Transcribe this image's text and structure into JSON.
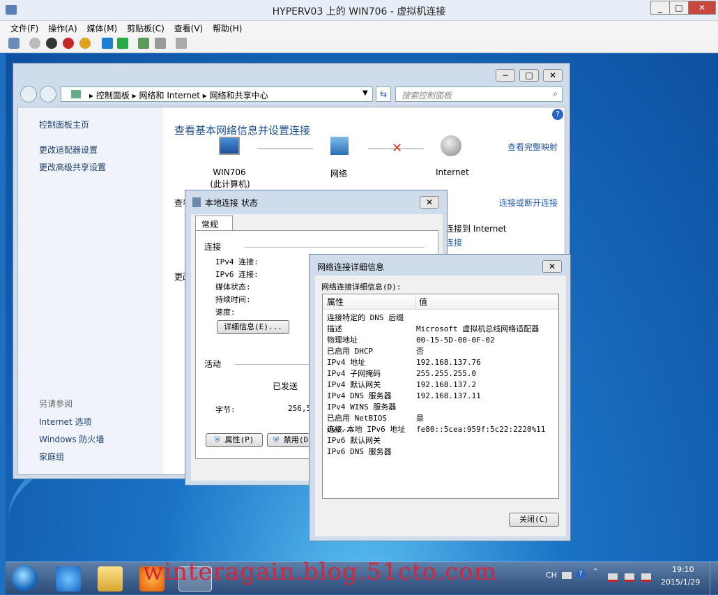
{
  "vm_window": {
    "title": "HYPERV03 上的 WIN706 - 虚拟机连接",
    "menu": [
      "文件(F)",
      "操作(A)",
      "媒体(M)",
      "剪贴板(C)",
      "查看(V)",
      "帮助(H)"
    ],
    "win_buttons": [
      "_",
      "□",
      "✕"
    ]
  },
  "explorer": {
    "breadcrumb": [
      "控制面板",
      "网络和 Internet",
      "网络和共享中心"
    ],
    "search_placeholder": "搜索控制面板",
    "left_nav": [
      "控制面板主页",
      "更改适配器设置",
      "更改高级共享设置"
    ],
    "see_also_title": "另请参阅",
    "see_also": [
      "Internet 选项",
      "Windows 防火墙",
      "家庭组"
    ],
    "heading": "查看基本网络信息并设置连接",
    "full_map": "查看完整映射",
    "nodes": [
      "WIN706",
      "(此计算机)",
      "网络",
      "Internet"
    ],
    "partial_heading_1": "查看",
    "partial_heading_2": "更改",
    "connect_link": "连接或断开连接",
    "connect_to_internet": "连接到 Internet",
    "partial_link": "连接"
  },
  "status_dialog": {
    "title": "本地连接 状态",
    "tab": "常规",
    "section_connection": "连接",
    "fields": [
      "IPv4 连接:",
      "IPv6 连接:",
      "媒体状态:",
      "持续时间:",
      "速度:"
    ],
    "details_button": "详细信息(E)...",
    "section_activity": "活动",
    "sent": "已发送",
    "bytes_label": "字节:",
    "bytes_value": "256,5",
    "properties_button": "属性(P)",
    "disable_button": "禁用(D"
  },
  "details_dialog": {
    "title": "网络连接详细信息",
    "subtitle": "网络连接详细信息(D):",
    "col_property": "属性",
    "col_value": "值",
    "rows": [
      {
        "k": "连接特定的 DNS 后缀",
        "v": ""
      },
      {
        "k": "描述",
        "v": "Microsoft 虚拟机总线网络适配器"
      },
      {
        "k": "物理地址",
        "v": "00-15-5D-00-0F-02"
      },
      {
        "k": "已启用 DHCP",
        "v": "否"
      },
      {
        "k": "IPv4 地址",
        "v": "192.168.137.76"
      },
      {
        "k": "IPv4 子网掩码",
        "v": "255.255.255.0"
      },
      {
        "k": "IPv4 默认网关",
        "v": "192.168.137.2"
      },
      {
        "k": "IPv4 DNS 服务器",
        "v": "192.168.137.11"
      },
      {
        "k": "IPv4 WINS 服务器",
        "v": ""
      },
      {
        "k": "已启用 NetBIOS ove...",
        "v": "是"
      },
      {
        "k": "连接-本地 IPv6 地址",
        "v": "fe80::5cea:959f:5c22:2220%11"
      },
      {
        "k": "IPv6 默认网关",
        "v": ""
      },
      {
        "k": "IPv6 DNS 服务器",
        "v": ""
      }
    ],
    "close_button": "关闭(C)"
  },
  "taskbar": {
    "lang": "CH",
    "time": "19:10",
    "date": "2015/1/29"
  },
  "watermark": "winteragain.blog.51cto.com"
}
